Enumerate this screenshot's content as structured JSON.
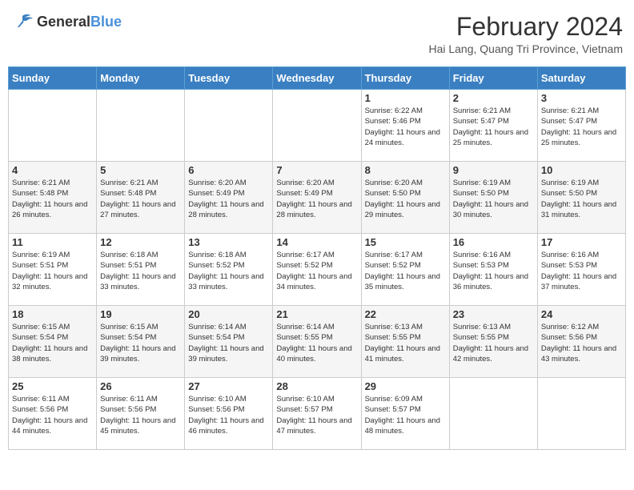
{
  "header": {
    "logo_general": "General",
    "logo_blue": "Blue",
    "title": "February 2024",
    "subtitle": "Hai Lang, Quang Tri Province, Vietnam"
  },
  "days_of_week": [
    "Sunday",
    "Monday",
    "Tuesday",
    "Wednesday",
    "Thursday",
    "Friday",
    "Saturday"
  ],
  "weeks": [
    [
      {
        "day": "",
        "info": ""
      },
      {
        "day": "",
        "info": ""
      },
      {
        "day": "",
        "info": ""
      },
      {
        "day": "",
        "info": ""
      },
      {
        "day": "1",
        "info": "Sunrise: 6:22 AM\nSunset: 5:46 PM\nDaylight: 11 hours and 24 minutes."
      },
      {
        "day": "2",
        "info": "Sunrise: 6:21 AM\nSunset: 5:47 PM\nDaylight: 11 hours and 25 minutes."
      },
      {
        "day": "3",
        "info": "Sunrise: 6:21 AM\nSunset: 5:47 PM\nDaylight: 11 hours and 25 minutes."
      }
    ],
    [
      {
        "day": "4",
        "info": "Sunrise: 6:21 AM\nSunset: 5:48 PM\nDaylight: 11 hours and 26 minutes."
      },
      {
        "day": "5",
        "info": "Sunrise: 6:21 AM\nSunset: 5:48 PM\nDaylight: 11 hours and 27 minutes."
      },
      {
        "day": "6",
        "info": "Sunrise: 6:20 AM\nSunset: 5:49 PM\nDaylight: 11 hours and 28 minutes."
      },
      {
        "day": "7",
        "info": "Sunrise: 6:20 AM\nSunset: 5:49 PM\nDaylight: 11 hours and 28 minutes."
      },
      {
        "day": "8",
        "info": "Sunrise: 6:20 AM\nSunset: 5:50 PM\nDaylight: 11 hours and 29 minutes."
      },
      {
        "day": "9",
        "info": "Sunrise: 6:19 AM\nSunset: 5:50 PM\nDaylight: 11 hours and 30 minutes."
      },
      {
        "day": "10",
        "info": "Sunrise: 6:19 AM\nSunset: 5:50 PM\nDaylight: 11 hours and 31 minutes."
      }
    ],
    [
      {
        "day": "11",
        "info": "Sunrise: 6:19 AM\nSunset: 5:51 PM\nDaylight: 11 hours and 32 minutes."
      },
      {
        "day": "12",
        "info": "Sunrise: 6:18 AM\nSunset: 5:51 PM\nDaylight: 11 hours and 33 minutes."
      },
      {
        "day": "13",
        "info": "Sunrise: 6:18 AM\nSunset: 5:52 PM\nDaylight: 11 hours and 33 minutes."
      },
      {
        "day": "14",
        "info": "Sunrise: 6:17 AM\nSunset: 5:52 PM\nDaylight: 11 hours and 34 minutes."
      },
      {
        "day": "15",
        "info": "Sunrise: 6:17 AM\nSunset: 5:52 PM\nDaylight: 11 hours and 35 minutes."
      },
      {
        "day": "16",
        "info": "Sunrise: 6:16 AM\nSunset: 5:53 PM\nDaylight: 11 hours and 36 minutes."
      },
      {
        "day": "17",
        "info": "Sunrise: 6:16 AM\nSunset: 5:53 PM\nDaylight: 11 hours and 37 minutes."
      }
    ],
    [
      {
        "day": "18",
        "info": "Sunrise: 6:15 AM\nSunset: 5:54 PM\nDaylight: 11 hours and 38 minutes."
      },
      {
        "day": "19",
        "info": "Sunrise: 6:15 AM\nSunset: 5:54 PM\nDaylight: 11 hours and 39 minutes."
      },
      {
        "day": "20",
        "info": "Sunrise: 6:14 AM\nSunset: 5:54 PM\nDaylight: 11 hours and 39 minutes."
      },
      {
        "day": "21",
        "info": "Sunrise: 6:14 AM\nSunset: 5:55 PM\nDaylight: 11 hours and 40 minutes."
      },
      {
        "day": "22",
        "info": "Sunrise: 6:13 AM\nSunset: 5:55 PM\nDaylight: 11 hours and 41 minutes."
      },
      {
        "day": "23",
        "info": "Sunrise: 6:13 AM\nSunset: 5:55 PM\nDaylight: 11 hours and 42 minutes."
      },
      {
        "day": "24",
        "info": "Sunrise: 6:12 AM\nSunset: 5:56 PM\nDaylight: 11 hours and 43 minutes."
      }
    ],
    [
      {
        "day": "25",
        "info": "Sunrise: 6:11 AM\nSunset: 5:56 PM\nDaylight: 11 hours and 44 minutes."
      },
      {
        "day": "26",
        "info": "Sunrise: 6:11 AM\nSunset: 5:56 PM\nDaylight: 11 hours and 45 minutes."
      },
      {
        "day": "27",
        "info": "Sunrise: 6:10 AM\nSunset: 5:56 PM\nDaylight: 11 hours and 46 minutes."
      },
      {
        "day": "28",
        "info": "Sunrise: 6:10 AM\nSunset: 5:57 PM\nDaylight: 11 hours and 47 minutes."
      },
      {
        "day": "29",
        "info": "Sunrise: 6:09 AM\nSunset: 5:57 PM\nDaylight: 11 hours and 48 minutes."
      },
      {
        "day": "",
        "info": ""
      },
      {
        "day": "",
        "info": ""
      }
    ]
  ]
}
